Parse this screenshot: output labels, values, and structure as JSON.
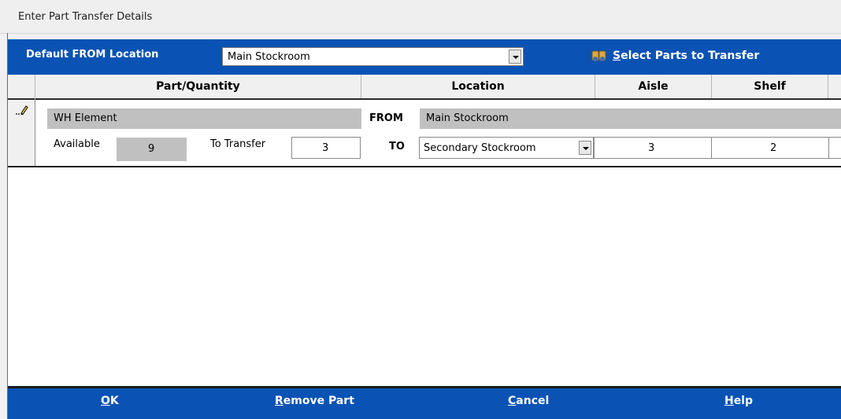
{
  "window": {
    "title": "Enter Part Transfer Details"
  },
  "toolbar": {
    "default_from_label": "Default FROM Location",
    "default_from_value": "Main Stockroom",
    "select_parts_mnemonic": "S",
    "select_parts_rest": "elect Parts to Transfer"
  },
  "grid": {
    "headers": [
      "Part/Quantity",
      "Location",
      "Aisle",
      "Shelf",
      ""
    ],
    "row": {
      "part_name": "WH Element",
      "available_label": "Available",
      "available_value": "9",
      "to_transfer_label": "To Transfer",
      "to_transfer_value": "3",
      "from_label": "FROM",
      "from_location": "Main Stockroom",
      "to_label": "TO",
      "to_location": "Secondary Stockroom",
      "aisle": "3",
      "shelf": "2"
    }
  },
  "footer": {
    "ok_mnemonic": "O",
    "ok_rest": "K",
    "remove_mnemonic": "R",
    "remove_rest": "emove Part",
    "cancel_mnemonic": "C",
    "cancel_rest": "ancel",
    "help_mnemonic": "H",
    "help_rest": "elp"
  },
  "colors": {
    "accent": "#0a53b4",
    "readonly_field": "#c0c0c0",
    "header_bg": "#f0f0f0"
  }
}
